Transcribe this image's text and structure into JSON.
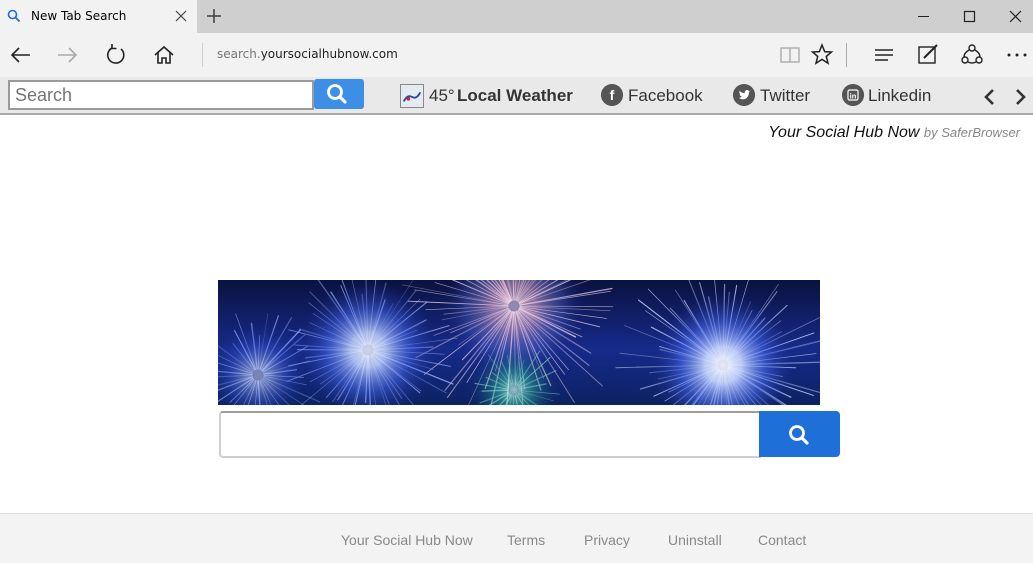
{
  "browser": {
    "tab_title": "New Tab Search",
    "url_prefix": "search.",
    "url_host": "yoursocialhubnow.com"
  },
  "toolbar": {
    "search_placeholder": "Search",
    "weather_temp": "45°",
    "weather_label": "Local Weather",
    "links": [
      "Facebook",
      "Twitter",
      "Linkedin"
    ]
  },
  "brand": {
    "name": "Your Social Hub Now",
    "by": "by SaferBrowser"
  },
  "footer": {
    "links": [
      "Your Social Hub Now",
      "Terms",
      "Privacy",
      "Uninstall",
      "Contact"
    ]
  },
  "colors": {
    "toolbar_search_button": "#3d8fe6",
    "main_search_button": "#1f6fd8",
    "titlebar": "#cfcfcf",
    "active_tab": "#f2f2f2"
  },
  "icons": [
    "search-icon",
    "close-icon",
    "plus-icon",
    "minimize-icon",
    "maximize-icon",
    "back-icon",
    "forward-icon",
    "refresh-icon",
    "home-icon",
    "reading-view-icon",
    "favorite-star-icon",
    "hub-icon",
    "web-note-icon",
    "share-icon",
    "more-icon",
    "weather-icon",
    "facebook-icon",
    "twitter-icon",
    "linkedin-icon",
    "chevron-left-icon",
    "chevron-right-icon"
  ]
}
